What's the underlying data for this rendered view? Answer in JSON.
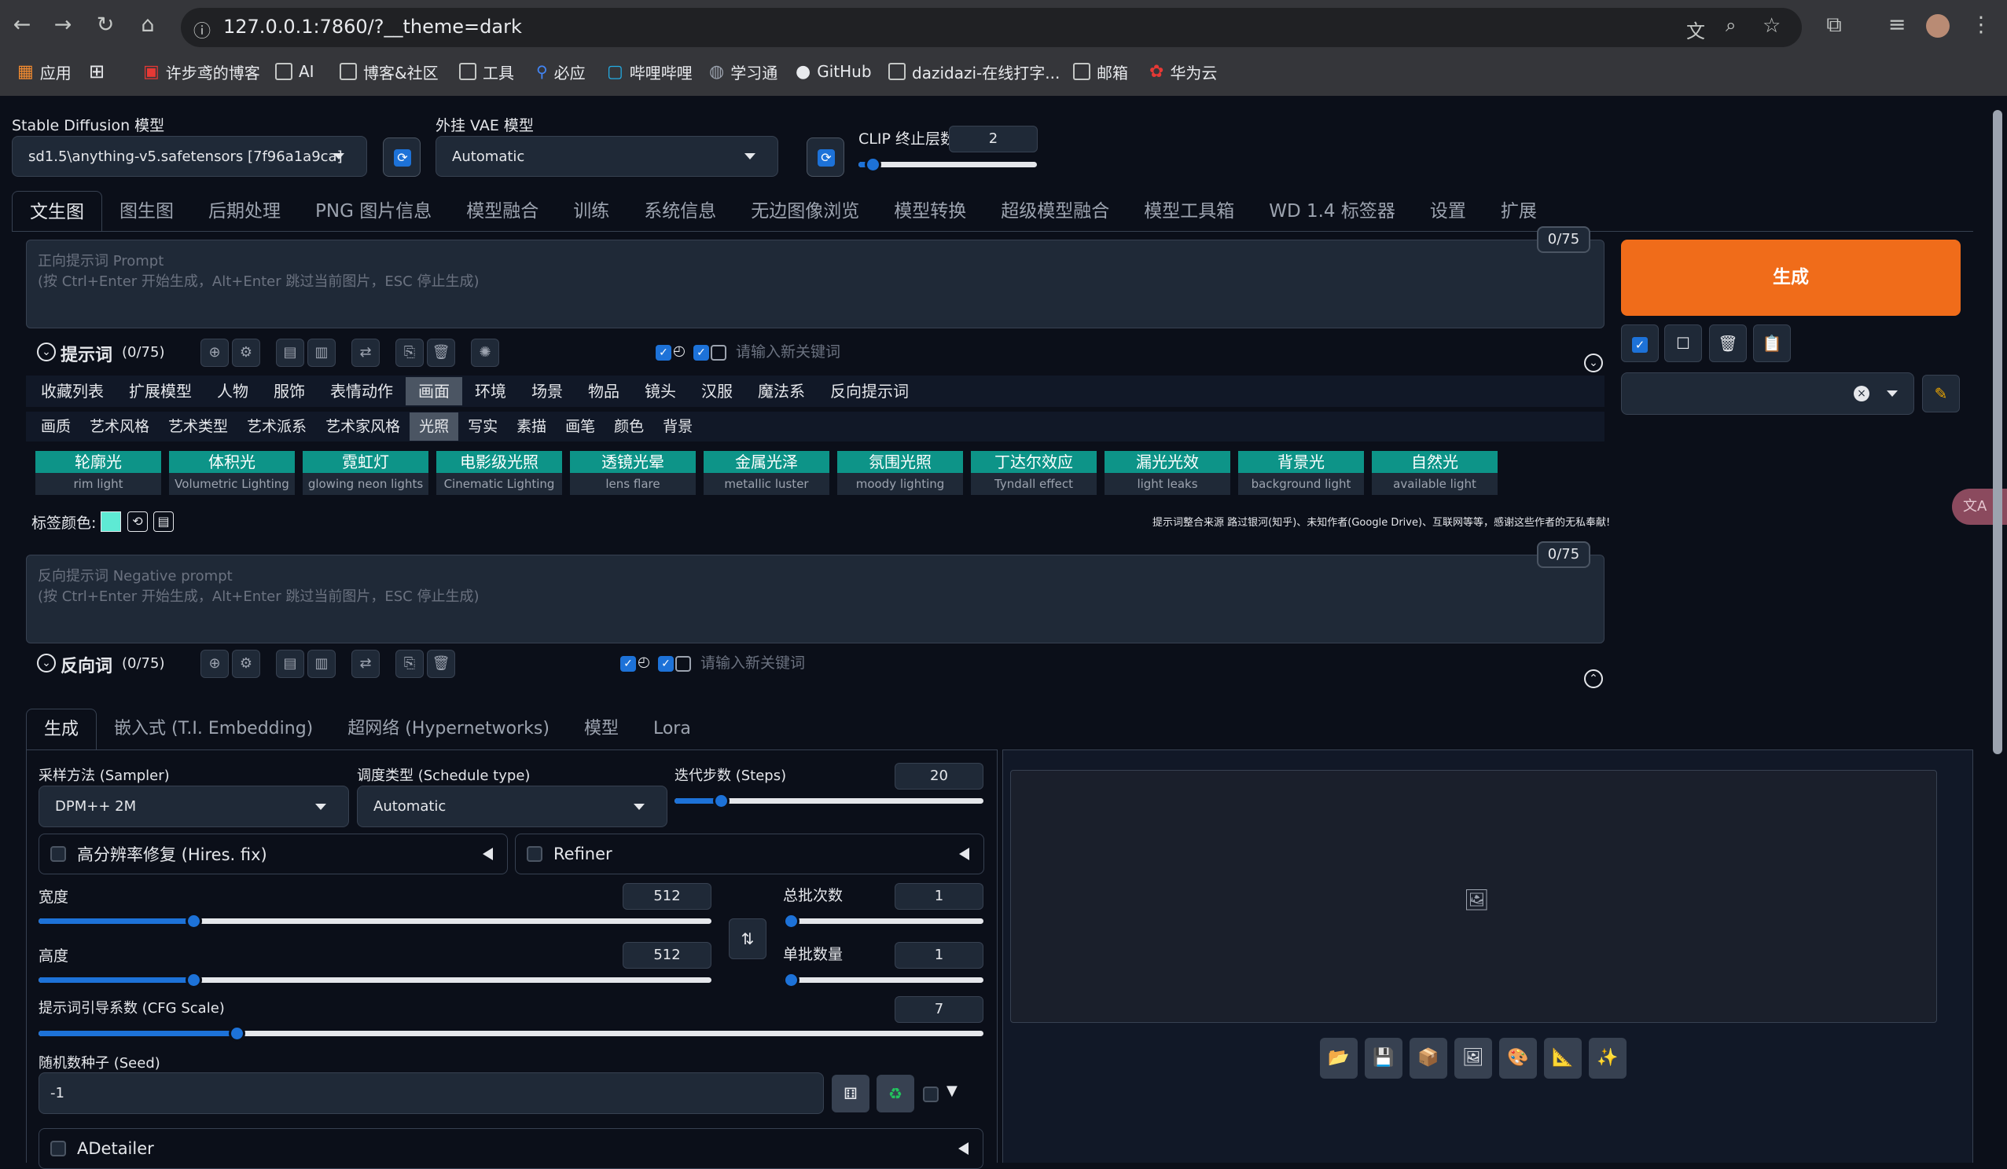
{
  "browser": {
    "url": "127.0.0.1:7860/?__theme=dark",
    "bookmarks": [
      "应用",
      "",
      "许步鸢的博客",
      "AI",
      "博客&社区",
      "工具",
      "必应",
      "哔哩哔哩",
      "学习通",
      "GitHub",
      "dazidazi-在线打字...",
      "邮箱",
      "华为云"
    ]
  },
  "top": {
    "sd_model_label": "Stable Diffusion 模型",
    "sd_model_value": "sd1.5\\anything-v5.safetensors [7f96a1a9ca]",
    "vae_label": "外挂 VAE 模型",
    "vae_value": "Automatic",
    "clip_label": "CLIP 终止层数",
    "clip_value": "2",
    "clip_fraction": 0.08
  },
  "main_tabs": [
    "文生图",
    "图生图",
    "后期处理",
    "PNG 图片信息",
    "模型融合",
    "训练",
    "系统信息",
    "无边图像浏览",
    "模型转换",
    "超级模型融合",
    "模型工具箱",
    "WD 1.4 标签器",
    "设置",
    "扩展"
  ],
  "prompt": {
    "counter": "0/75",
    "placeholder_line1": "正向提示词 Prompt",
    "placeholder_line2": "(按 Ctrl+Enter 开始生成，Alt+Enter 跳过当前图片，ESC 停止生成)",
    "title": "提示词",
    "count": "(0/75)",
    "keyword_placeholder": "请输入新关键词"
  },
  "categories": [
    "收藏列表",
    "扩展模型",
    "人物",
    "服饰",
    "表情动作",
    "画面",
    "环境",
    "场景",
    "物品",
    "镜头",
    "汉服",
    "魔法系",
    "反向提示词"
  ],
  "subcategories": [
    "画质",
    "艺术风格",
    "艺术类型",
    "艺术派系",
    "艺术家风格",
    "光照",
    "写实",
    "素描",
    "画笔",
    "颜色",
    "背景"
  ],
  "tags": [
    {
      "zh": "轮廓光",
      "en": "rim light"
    },
    {
      "zh": "体积光",
      "en": "Volumetric Lighting"
    },
    {
      "zh": "霓虹灯",
      "en": "glowing neon lights"
    },
    {
      "zh": "电影级光照",
      "en": "Cinematic Lighting"
    },
    {
      "zh": "透镜光晕",
      "en": "lens flare"
    },
    {
      "zh": "金属光泽",
      "en": "metallic luster"
    },
    {
      "zh": "氛围光照",
      "en": "moody lighting"
    },
    {
      "zh": "丁达尔效应",
      "en": "Tyndall effect"
    },
    {
      "zh": "漏光光效",
      "en": "light leaks"
    },
    {
      "zh": "背景光",
      "en": "background light"
    },
    {
      "zh": "自然光",
      "en": "available light"
    }
  ],
  "tag_color_label": "标签颜色:",
  "credits": "提示词整合来源 路过银河(知乎)、未知作者(Google Drive)、互联网等等，感谢这些作者的无私奉献!",
  "negative": {
    "counter": "0/75",
    "placeholder_line1": "反向提示词 Negative prompt",
    "placeholder_line2": "(按 Ctrl+Enter 开始生成，Alt+Enter 跳过当前图片，ESC 停止生成)",
    "title": "反向词",
    "count": "(0/75)",
    "keyword_placeholder": "请输入新关键词"
  },
  "generate_button": "生成",
  "sub_tabs": [
    "生成",
    "嵌入式 (T.I. Embedding)",
    "超网络 (Hypernetworks)",
    "模型",
    "Lora"
  ],
  "params": {
    "sampler_label": "采样方法 (Sampler)",
    "sampler_value": "DPM++ 2M",
    "schedule_label": "调度类型 (Schedule type)",
    "schedule_value": "Automatic",
    "steps_label": "迭代步数 (Steps)",
    "steps_value": "20",
    "steps_fraction": 0.15,
    "hires_label": "高分辨率修复 (Hires. fix)",
    "refiner_label": "Refiner",
    "width_label": "宽度",
    "width_value": "512",
    "width_fraction": 0.23,
    "height_label": "高度",
    "height_value": "512",
    "height_fraction": 0.23,
    "batch_count_label": "总批次数",
    "batch_count_value": "1",
    "batch_count_fraction": 0.0,
    "batch_size_label": "单批数量",
    "batch_size_value": "1",
    "batch_size_fraction": 0.0,
    "cfg_label": "提示词引导系数 (CFG Scale)",
    "cfg_value": "7",
    "cfg_fraction": 0.21,
    "seed_label": "随机数种子 (Seed)",
    "seed_value": "-1",
    "adetailer_label": "ADetailer"
  },
  "colors": {
    "accent": "#1d72d8",
    "generate": "#f06c1a",
    "tag": "#0d9488"
  }
}
